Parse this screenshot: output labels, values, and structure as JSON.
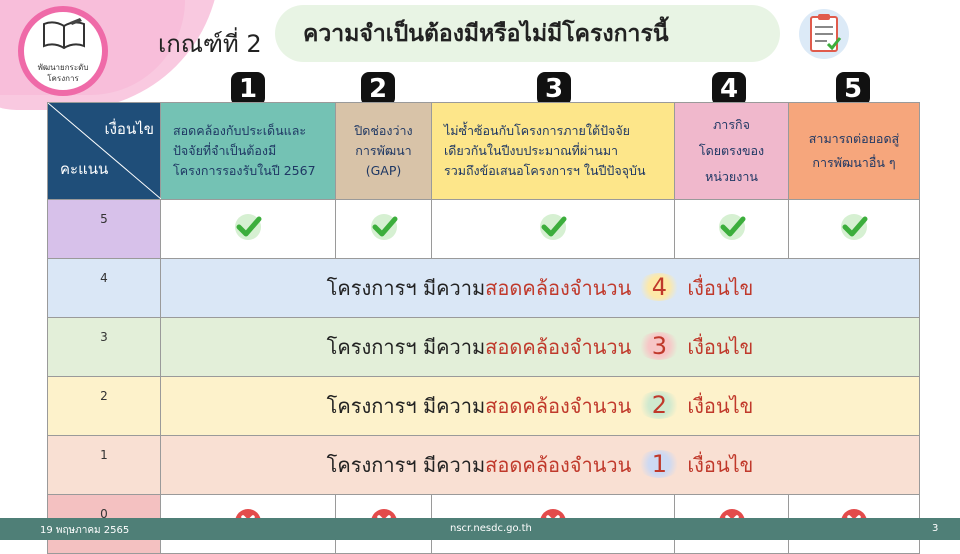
{
  "logo": {
    "line1": "พัฒนายกระดับ",
    "line2": "โครงการ"
  },
  "criteria_label": "เกณฑ์ที่ 2",
  "title": "ความจำเป็นต้องมีหรือไม่มีโครงการนี้",
  "column_numbers": [
    "1",
    "2",
    "3",
    "4",
    "5"
  ],
  "header": {
    "corner_top": "เงื่อนไข",
    "corner_bottom": "คะแนน",
    "columns": [
      {
        "lines": [
          "สอดคล้องกับประเด็นและ",
          "ปัจจัยที่จำเป็นต้องมี",
          "โครงการรองรับในปี 2567"
        ]
      },
      {
        "lines": [
          "ปิดช่องว่าง",
          "การพัฒนา",
          "(GAP)"
        ]
      },
      {
        "lines": [
          "ไม่ซ้ำซ้อนกับโครงการภายใต้ปัจจัย",
          "เดียวกันในปีงบประมาณที่ผ่านมา",
          "รวมถึงข้อเสนอโครงการฯ ในปีปัจจุบัน"
        ]
      },
      {
        "lines": [
          "ภารกิจ",
          "โดยตรงของ",
          "หน่วยงาน"
        ]
      },
      {
        "lines": [
          "สามารถต่อยอดสู่",
          "การพัฒนาอื่น ๆ"
        ]
      }
    ]
  },
  "rows": [
    {
      "score": "5",
      "color": "#d7c1ea",
      "type": "check"
    },
    {
      "score": "4",
      "color": "#dae7f6",
      "type": "message",
      "count": "4",
      "glow": "#fde9a8"
    },
    {
      "score": "3",
      "color": "#e3efd9",
      "type": "message",
      "count": "3",
      "glow": "#f7c6c6"
    },
    {
      "score": "2",
      "color": "#fdf2cb",
      "type": "message",
      "count": "2",
      "glow": "#cfe9cf"
    },
    {
      "score": "1",
      "color": "#f9e0d3",
      "type": "message",
      "count": "1",
      "glow": "#cdd9f2"
    },
    {
      "score": "0",
      "color": "#f4c1c1",
      "type": "cross"
    }
  ],
  "message": {
    "prefix": "โครงการฯ มีความ",
    "highlight": "สอดคล้องจำนวน",
    "suffix": "เงื่อนไข"
  },
  "colors": {
    "check": "#3cae3c",
    "cross": "#e34b4b",
    "footer": "#4f7f77"
  },
  "footer": {
    "date": "19 พฤษภาคม 2565",
    "site": "nscr.nesdc.go.th",
    "page": "3"
  }
}
